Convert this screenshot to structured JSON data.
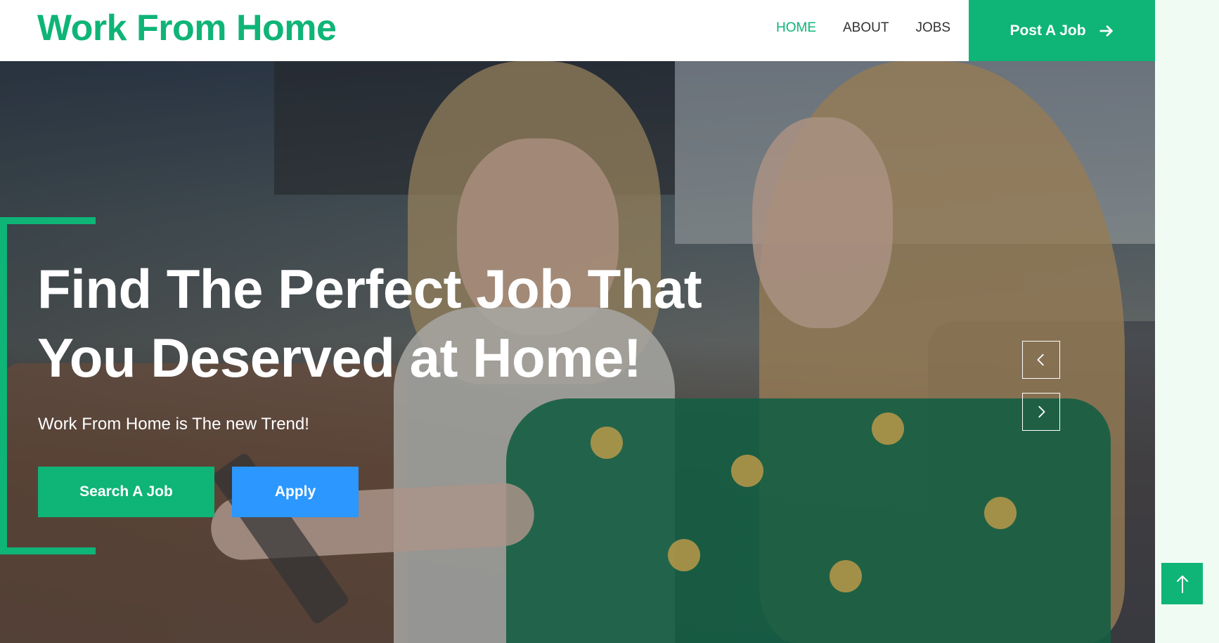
{
  "header": {
    "logo": "Work From Home",
    "nav": [
      {
        "label": "HOME",
        "active": true
      },
      {
        "label": "ABOUT",
        "active": false
      },
      {
        "label": "JOBS",
        "active": false
      }
    ],
    "post_job_label": "Post A Job",
    "post_job_icon": "arrow-right-icon"
  },
  "hero": {
    "title_line1": "Find The Perfect Job That",
    "title_line2": "You Deserved at Home!",
    "subtitle": "Work From Home is The new Trend!",
    "search_button": "Search A Job",
    "apply_button": "Apply",
    "prev_icon": "chevron-left-icon",
    "next_icon": "chevron-right-icon"
  },
  "back_to_top_icon": "arrow-up-icon",
  "colors": {
    "accent": "#0fb477",
    "apply": "#2b97ff",
    "side_bg": "#f0fcf3"
  }
}
